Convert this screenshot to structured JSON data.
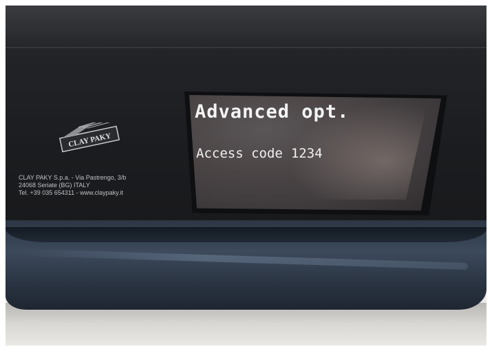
{
  "display": {
    "title": "Advanced opt.",
    "label": "Access code",
    "code": "1234"
  },
  "brand": {
    "logo_text": "CLAY PAKY",
    "address_line1": "CLAY PAKY S.p.a. - Via Pastrengo, 3/b",
    "address_line2": "24068 Seriate (BG) ITALY",
    "address_line3": "Tel. +39 035 654311 - www.claypaky.it"
  },
  "colors": {
    "lcd_text": "#f4f4f4",
    "panel": "#1b1c1f",
    "bumper": "#3d4a5c"
  }
}
